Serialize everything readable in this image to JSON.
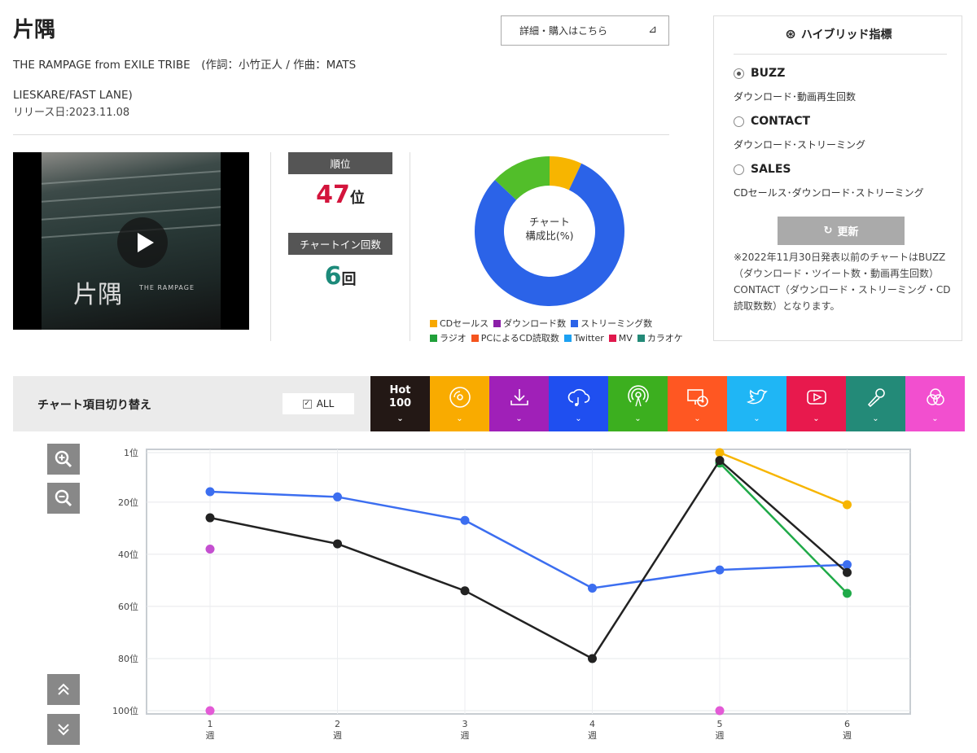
{
  "song": {
    "title": "片隅",
    "artist_credit": "THE RAMPAGE from EXILE TRIBE　(作詞：小竹正人 / 作曲：MATS LIESKARE/FAST LANE)",
    "release": "リリース日:2023.11.08",
    "detail_button": "詳細・購入はこちら"
  },
  "video": {
    "thumb_title": "片隅",
    "thumb_band": "THE RAMPAGE"
  },
  "stats": {
    "rank_label": "順位",
    "rank": "47",
    "rank_suffix": "位",
    "chartin_label": "チャートイン回数",
    "chartin": "6",
    "chartin_suffix": "回"
  },
  "composition": {
    "center_line1": "チャート",
    "center_line2": "構成比(%)",
    "slices": [
      {
        "name": "CDセールス",
        "value": 7,
        "color": "#f7b500"
      },
      {
        "name": "ストリーミング数",
        "value": 80,
        "color": "#2b63e8"
      },
      {
        "name": "ラジオ",
        "value": 13,
        "color": "#52be2a"
      }
    ],
    "legend_row1": [
      {
        "name": "CDセールス",
        "color": "#f7a800"
      },
      {
        "name": "ダウンロード数",
        "color": "#8b1fa8"
      },
      {
        "name": "ストリーミング数",
        "color": "#2b63e8"
      }
    ],
    "legend_row2": [
      {
        "name": "ラジオ",
        "color": "#20a03a"
      },
      {
        "name": "PCによるCD読取数",
        "color": "#f5541e"
      },
      {
        "name": "Twitter",
        "color": "#1da1f2"
      },
      {
        "name": "MV",
        "color": "#e0184c"
      },
      {
        "name": "カラオケ",
        "color": "#238a78"
      }
    ]
  },
  "hybrid": {
    "title": "ハイブリッド指標",
    "options": [
      {
        "label": "BUZZ",
        "desc": "ダウンロード･動画再生回数",
        "selected": true
      },
      {
        "label": "CONTACT",
        "desc": "ダウンロード･ストリーミング",
        "selected": false
      },
      {
        "label": "SALES",
        "desc": "CDセールス･ダウンロード･ストリーミング",
        "selected": false
      }
    ],
    "update_label": "更新",
    "note": "※2022年11月30日発表以前のチャートはBUZZ（ダウンロード・ツイート数・動画再生回数）CONTACT（ダウンロード・ストリーミング・CD読取数数）となります。"
  },
  "switcher": {
    "label": "チャート項目切り替え",
    "all_label": "ALL",
    "hot_line1": "Hot",
    "hot_line2": "100",
    "tabs": [
      {
        "icon": "cd-icon",
        "color": "#f9ab00"
      },
      {
        "icon": "download-icon",
        "color": "#a020b8"
      },
      {
        "icon": "streaming-cloud-icon",
        "color": "#1f4ff0"
      },
      {
        "icon": "radio-icon",
        "color": "#3caf1f"
      },
      {
        "icon": "pc-cd-icon",
        "color": "#ff5722"
      },
      {
        "icon": "twitter-icon",
        "color": "#1fb6f5"
      },
      {
        "icon": "youtube-icon",
        "color": "#e8194d"
      },
      {
        "icon": "microphone-icon",
        "color": "#238a78"
      },
      {
        "icon": "hybrid-icon",
        "color": "#f24fcf"
      }
    ],
    "hot_color": "#231815"
  },
  "chart_data": {
    "type": "line",
    "x": [
      1,
      2,
      3,
      4,
      5,
      6
    ],
    "x_tick_labels": [
      "1\n週",
      "2\n週",
      "3\n週",
      "4\n週",
      "5\n週",
      "6\n週"
    ],
    "y_ticks": [
      1,
      20,
      40,
      60,
      80,
      100
    ],
    "y_tick_labels": [
      "1位",
      "20位",
      "40位",
      "60位",
      "80位",
      "100位"
    ],
    "ylim": [
      1,
      100
    ],
    "y_inverted": true,
    "grid": true,
    "series": [
      {
        "color": "#f7b500",
        "values": [
          null,
          null,
          null,
          null,
          1,
          21
        ]
      },
      {
        "color": "#1faa48",
        "values": [
          null,
          null,
          null,
          null,
          5,
          55
        ]
      },
      {
        "color": "#3c6ef0",
        "values": [
          16,
          18,
          27,
          53,
          46,
          44
        ]
      },
      {
        "color": "#222222",
        "values": [
          26,
          36,
          54,
          80,
          4,
          47
        ]
      },
      {
        "color": "#c44fd0",
        "values": [
          38,
          null,
          null,
          null,
          null,
          null
        ],
        "points_only": true
      },
      {
        "color": "#e35ad6",
        "values": [
          100,
          null,
          null,
          null,
          100,
          null
        ],
        "points_only": true
      }
    ]
  }
}
